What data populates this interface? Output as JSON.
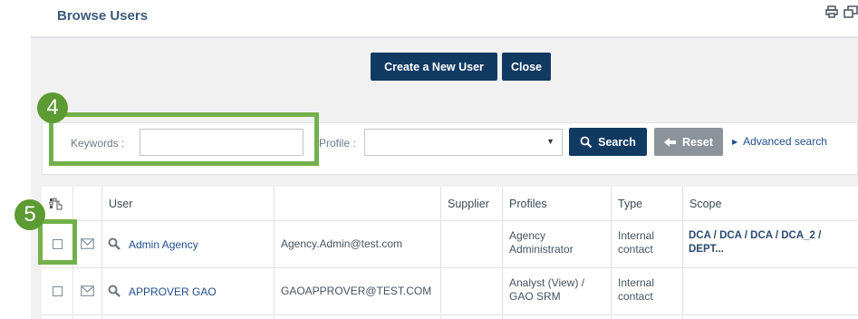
{
  "header": {
    "title": "Browse Users",
    "print_icon": "printer-icon",
    "export_icon": "export-window-icon"
  },
  "actions": {
    "create_label": "Create a New User",
    "close_label": "Close"
  },
  "search": {
    "keywords_label": "Keywords :",
    "keywords_value": "",
    "profile_label": "Profile :",
    "profile_value": "",
    "search_label": "Search",
    "reset_label": "Reset",
    "advanced_label": "Advanced search"
  },
  "annotations": {
    "badge_keywords": "4",
    "badge_checkbox": "5",
    "highlight_color": "#73b04a"
  },
  "table": {
    "columns": [
      "",
      "",
      "User",
      "",
      "Supplier",
      "Profiles",
      "Type",
      "Scope"
    ],
    "rows": [
      {
        "user": "Admin Agency",
        "email": "Agency.Admin@test.com",
        "supplier": "",
        "profiles": "Agency Administrator",
        "type": "Internal contact",
        "scope": "DCA / DCA / DCA / DCA_2 / DEPT..."
      },
      {
        "user": "APPROVER GAO",
        "email": "GAOAPPROVER@TEST.COM",
        "supplier": "",
        "profiles": "Analyst (View) / GAO SRM",
        "type": "Internal contact",
        "scope": ""
      }
    ]
  },
  "colors": {
    "primary_button": "#113a63",
    "secondary_button": "#8c939b",
    "link": "#1f4e8c"
  }
}
